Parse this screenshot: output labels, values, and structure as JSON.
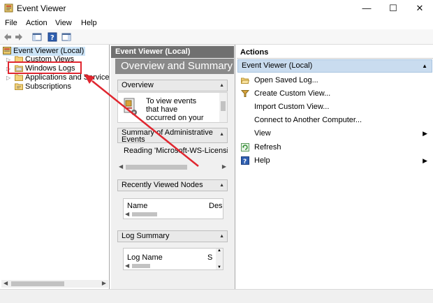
{
  "window": {
    "title": "Event Viewer",
    "minimize": "—",
    "maximize": "☐",
    "close": "✕"
  },
  "menu": [
    "File",
    "Action",
    "View",
    "Help"
  ],
  "tree": {
    "root": "Event Viewer (Local)",
    "items": [
      "Custom Views",
      "Windows Logs",
      "Applications and Services Logs",
      "Subscriptions"
    ]
  },
  "middle": {
    "header": "Event Viewer (Local)",
    "banner": "Overview and Summary",
    "overview": {
      "title": "Overview",
      "text": [
        "To view events",
        "that have",
        "occurred on your"
      ]
    },
    "summary": {
      "title": "Summary of Administrative Events",
      "text": "Reading 'Microsoft-WS-Licensing"
    },
    "recent": {
      "title": "Recently Viewed Nodes",
      "col_name": "Name",
      "col_desc": "Des"
    },
    "logsummary": {
      "title": "Log Summary",
      "col_name": "Log Name",
      "col_s": "S"
    }
  },
  "actions": {
    "header": "Actions",
    "subheader": "Event Viewer (Local)",
    "items": [
      "Open Saved Log...",
      "Create Custom View...",
      "Import Custom View...",
      "Connect to Another Computer...",
      "View",
      "Refresh",
      "Help"
    ]
  },
  "colors": {
    "highlight_box": "#e0262f",
    "arrow": "#e0262f",
    "actions_sub_bg": "#c9dcef",
    "mid_header": "#707070"
  }
}
